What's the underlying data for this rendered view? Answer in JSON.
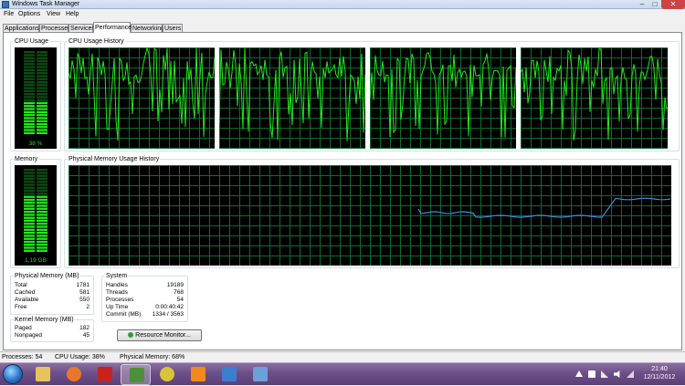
{
  "window": {
    "title": "Windows Task Manager",
    "min_glyph": "–",
    "max_glyph": "□",
    "close_glyph": "✕"
  },
  "menu": [
    "File",
    "Options",
    "View",
    "Help"
  ],
  "tabs": [
    {
      "label": "Applications",
      "active": false
    },
    {
      "label": "Processes",
      "active": false
    },
    {
      "label": "Services",
      "active": false
    },
    {
      "label": "Performance",
      "active": true
    },
    {
      "label": "Networking",
      "active": false
    },
    {
      "label": "Users",
      "active": false
    }
  ],
  "performance": {
    "cpu_usage": {
      "title": "CPU Usage",
      "value_text": "38 %",
      "level": 0.38
    },
    "cpu_history": {
      "title": "CPU Usage History",
      "cores": 4
    },
    "memory": {
      "title": "Memory",
      "value_text": "1,19 GB",
      "level": 0.68
    },
    "memory_history": {
      "title": "Physical Memory Usage History"
    },
    "physical_memory": {
      "title": "Physical Memory (MB)",
      "rows": [
        {
          "label": "Total",
          "value": "1781"
        },
        {
          "label": "Cached",
          "value": "581"
        },
        {
          "label": "Available",
          "value": "550"
        },
        {
          "label": "Free",
          "value": "2"
        }
      ]
    },
    "kernel_memory": {
      "title": "Kernel Memory (MB)",
      "rows": [
        {
          "label": "Paged",
          "value": "182"
        },
        {
          "label": "Nonpaged",
          "value": "45"
        }
      ]
    },
    "system": {
      "title": "System",
      "rows": [
        {
          "label": "Handles",
          "value": "19189"
        },
        {
          "label": "Threads",
          "value": "768"
        },
        {
          "label": "Processes",
          "value": "54"
        },
        {
          "label": "Up Time",
          "value": "0:00:40:42"
        },
        {
          "label": "Commit (MB)",
          "value": "1334 / 3563"
        }
      ]
    },
    "resource_monitor_button": "Resource Monitor..."
  },
  "status": {
    "processes": "Processes: 54",
    "cpu": "CPU Usage: 38%",
    "memory": "Physical Memory: 68%"
  },
  "taskbar": {
    "apps": [
      {
        "name": "explorer",
        "color": "#e8c25a",
        "active": false
      },
      {
        "name": "firefox",
        "color": "#e8772a",
        "active": false
      },
      {
        "name": "acrobat",
        "color": "#c8231c",
        "active": false
      },
      {
        "name": "task-manager",
        "color": "#4d8f3a",
        "active": true
      },
      {
        "name": "chrome",
        "color": "#d8c33a",
        "active": false
      },
      {
        "name": "vlc",
        "color": "#f08a1c",
        "active": false
      },
      {
        "name": "remote-desktop",
        "color": "#3c7fcf",
        "active": false
      },
      {
        "name": "paint",
        "color": "#6aa1d8",
        "active": false
      }
    ],
    "clock_time": "21:40",
    "clock_date": "12/11/2012"
  },
  "colors": {
    "graph_green": "#23e81c",
    "graph_grid": "#0a6d2f",
    "memory_line": "#3f8de0"
  }
}
